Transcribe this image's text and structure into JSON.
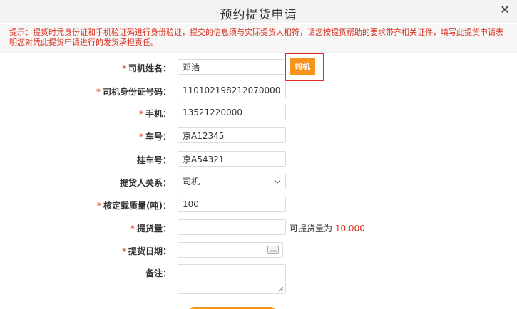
{
  "dialog": {
    "title": "预约提货申请",
    "close_glyph": "✕"
  },
  "notice": {
    "text": "提示：提货时凭身份证和手机验证码进行身份验证，提交的信息须与实际提货人相符，请您按提货帮助的要求带齐相关证件，填写此提货申请表明您对凭此提货申请进行的发货承担责任。"
  },
  "form": {
    "required_mark": "*",
    "driver_name": {
      "label": "司机姓名：",
      "value": "邓浩"
    },
    "driver_button": {
      "label": "司机"
    },
    "id_number": {
      "label": "司机身份证号码：",
      "value": "110102198212070000"
    },
    "phone": {
      "label": "手机：",
      "value": "13521220000"
    },
    "car_number": {
      "label": "车号：",
      "value": "京A12345"
    },
    "trailer_number": {
      "label": "挂车号：",
      "value": "京A54321"
    },
    "relation": {
      "label": "提货人关系：",
      "value": "司机"
    },
    "rated_load": {
      "label": "核定载质量(吨)：",
      "value": "100"
    },
    "pickup_amount": {
      "label": "提货量：",
      "value": "",
      "available_prefix": "可提货量为",
      "available_value": "10.000"
    },
    "pickup_date": {
      "label": "提货日期：",
      "value": ""
    },
    "remarks": {
      "label": "备注：",
      "value": ""
    }
  },
  "colors": {
    "accent_orange": "#f7941d",
    "required_red": "#d9301f",
    "highlight_red": "#e52b2b"
  }
}
